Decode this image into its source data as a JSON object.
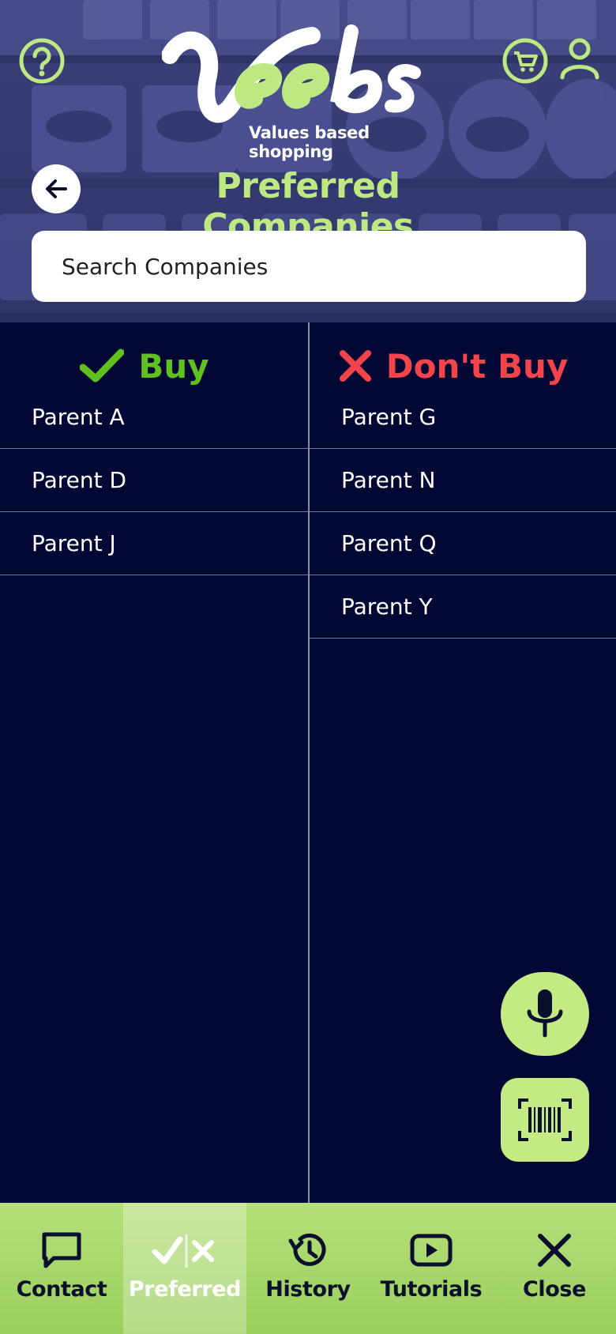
{
  "app": {
    "logo_text": "Veebs",
    "tagline": "Values based shopping",
    "page_title": "Preferred Companies"
  },
  "search": {
    "placeholder": "Search Companies",
    "value": ""
  },
  "columns": {
    "buy": {
      "label": "Buy",
      "items": [
        "Parent A",
        "Parent D",
        "Parent J"
      ]
    },
    "dont_buy": {
      "label": "Don't Buy",
      "items": [
        "Parent G",
        "Parent N",
        "Parent Q",
        "Parent Y"
      ]
    }
  },
  "tabs": [
    {
      "label": "Contact",
      "icon": "chat-icon"
    },
    {
      "label": "Preferred",
      "icon": "check-x-icon",
      "active": true
    },
    {
      "label": "History",
      "icon": "history-icon"
    },
    {
      "label": "Tutorials",
      "icon": "play-icon"
    },
    {
      "label": "Close",
      "icon": "close-icon"
    }
  ],
  "colors": {
    "background": "#020833",
    "accent": "#bde882",
    "buy": "#5fc01f",
    "dont_buy": "#f2444a"
  }
}
